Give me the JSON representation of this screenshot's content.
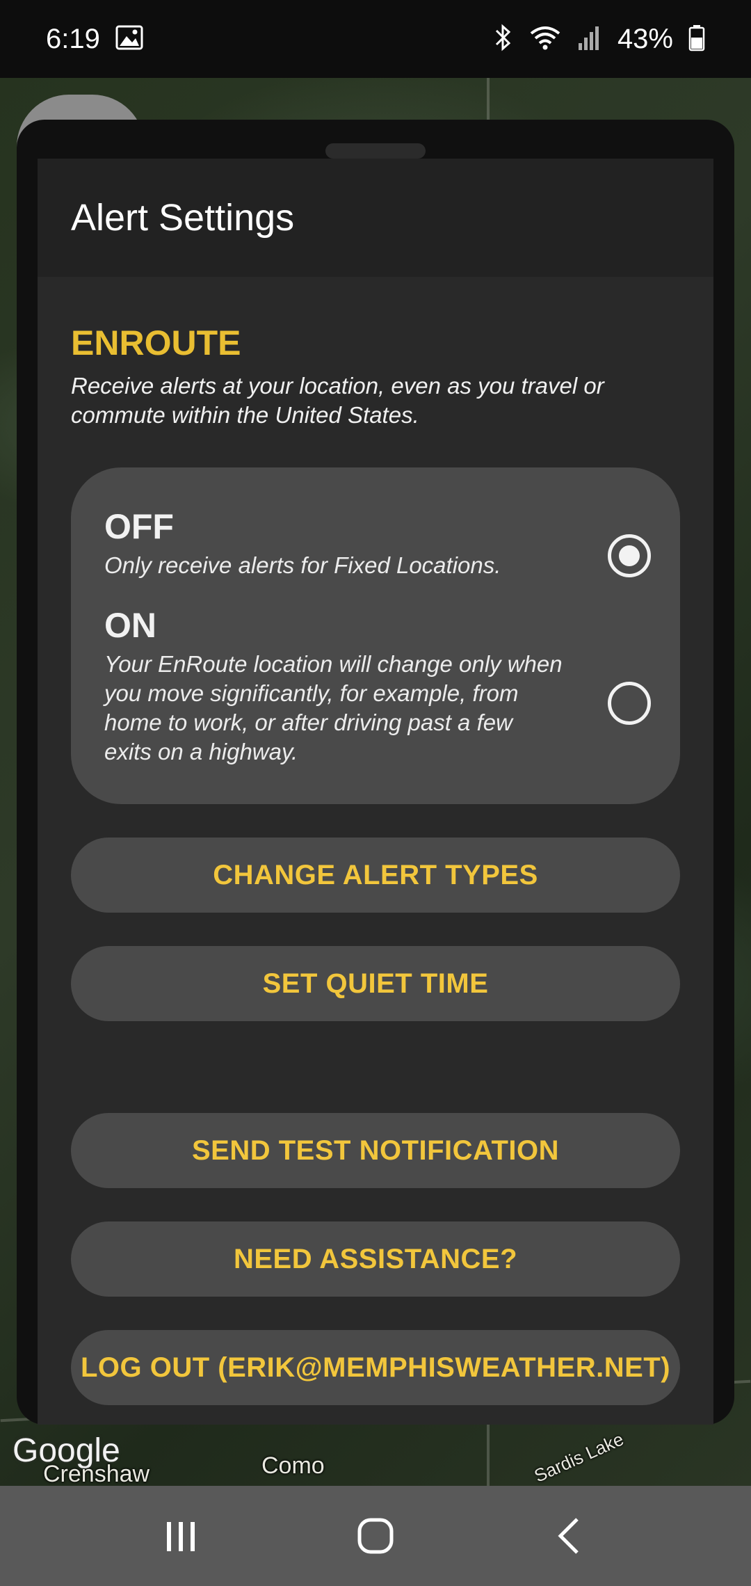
{
  "status_bar": {
    "time": "6:19",
    "battery_pct": "43%",
    "icons": [
      "image-icon",
      "bluetooth-icon",
      "wifi-icon",
      "signal-icon",
      "battery-icon"
    ]
  },
  "map": {
    "labels": {
      "como": "Como",
      "crenshaw": "Crenshaw",
      "sardis_lake": "Sardis Lake",
      "google": "Google"
    }
  },
  "sheet": {
    "title": "Alert Settings",
    "section": {
      "title": "ENROUTE",
      "description": "Receive alerts at your location, even as you travel or commute within the United States."
    },
    "options": [
      {
        "label": "OFF",
        "description": "Only receive alerts for Fixed Locations.",
        "selected": true
      },
      {
        "label": "ON",
        "description": "Your EnRoute location will change only when you move significantly, for example, from home to work, or after driving past a few exits on a highway.",
        "selected": false
      }
    ],
    "buttons": {
      "change_alert_types": "CHANGE ALERT TYPES",
      "set_quiet_time": "SET QUIET TIME",
      "send_test_notification": "SEND TEST NOTIFICATION",
      "need_assistance": "NEED ASSISTANCE?",
      "log_out": "LOG OUT (ERIK@MEMPHISWEATHER.NET)"
    }
  },
  "colors": {
    "accent": "#f2c63c",
    "section_title": "#e9be32",
    "sheet_bg": "#292929",
    "pill_bg": "#4a4a4a"
  }
}
